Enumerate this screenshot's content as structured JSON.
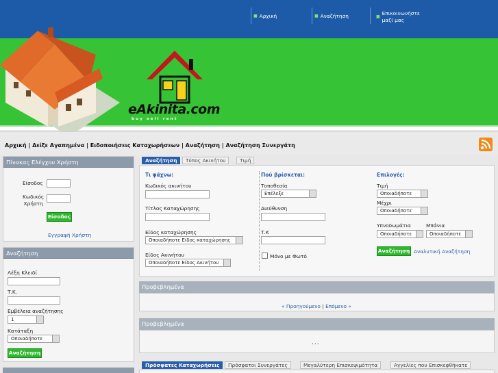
{
  "nav": {
    "home": "Αρχική",
    "search": "Αναζήτηση",
    "contact_1": "Επικοινωνήστε",
    "contact_2": "μαζί μας"
  },
  "logo": {
    "text": "eAkinita.com",
    "tagline": "buy sell rent"
  },
  "menu": "Αρχική | Δείξε Αγαπημένα | Ειδοποιήσεις Καταχωρήσεων | Αναζήτηση | Αναζήτηση Συνεργάτη",
  "control_panel": {
    "title": "Πίνακας Ελέγχου Χρήστη",
    "login_label": "Είσοδος",
    "code_label_1": "Κωδικός",
    "code_label_2": "Χρήστη",
    "login_button": "Είσοδος",
    "register_link": "Εγγραφή Χρήστη"
  },
  "side_search": {
    "title": "Αναζήτηση",
    "keyword_label": "Λέξη Κλειδί",
    "zip_label": "Τ.Κ.",
    "area_label": "Εμβέλεια αναζήτησης",
    "area_value": "1",
    "sort_label": "Κατάταξη",
    "sort_value": "Οποιαδήποτε",
    "button": "Αναζήτηση"
  },
  "main_tabs": [
    "Αναζήτηση",
    "Τύπος Ακινήτου",
    "Τιμή"
  ],
  "what": {
    "heading": "Τι ψάχνω:",
    "code_label": "Κωδικός ακινήτου",
    "title_label": "Τίτλος Καταχώρησης",
    "type_label": "Είδος καταχώρησης",
    "type_value": "Οποιαδήποτε Είδος καταχώρησης",
    "prop_label": "Είδος Ακινήτου",
    "prop_value": "Οποιαδήποτε Είδος Ακινήτου"
  },
  "where": {
    "heading": "Πού βρίσκεται:",
    "location_label": "Τοποθεσία",
    "location_value": "Επέλεξε",
    "address_label": "Διεύθυνση",
    "zip_label": "Τ.Κ",
    "photo_label": "Μόνο με Φωτό"
  },
  "options": {
    "heading": "Επιλογές:",
    "price_label": "Τιμή",
    "price_value": "Οποιαδήποτε",
    "to_label": "Μέχρι",
    "to_value": "Οποιαδήποτε",
    "bedrooms_label": "Υπνοδωμάτια",
    "bedrooms_value": "Οποιαδήποτε",
    "baths_label": "Μπάνια",
    "baths_value": "Οποιαδήποτε",
    "search_button": "Αναζήτηση",
    "advanced_link": "Αναλυτική Αναζήτηση"
  },
  "featured1": {
    "title": "Προβεβλημένα",
    "prev": "« Προηγούμενο",
    "sep": "|",
    "next": "Επόμενο »"
  },
  "featured2": {
    "title": "Προβεβλημένα",
    "dots": "..."
  },
  "bottom_tabs": [
    "Πρόσφατες Καταχωρήσεις",
    "Πρόσφατοι Συνεργάτες",
    "Μεγαλύτερη Επισκεψιμότητα",
    "Αγγελίες που Επισκεφθήκατε"
  ]
}
